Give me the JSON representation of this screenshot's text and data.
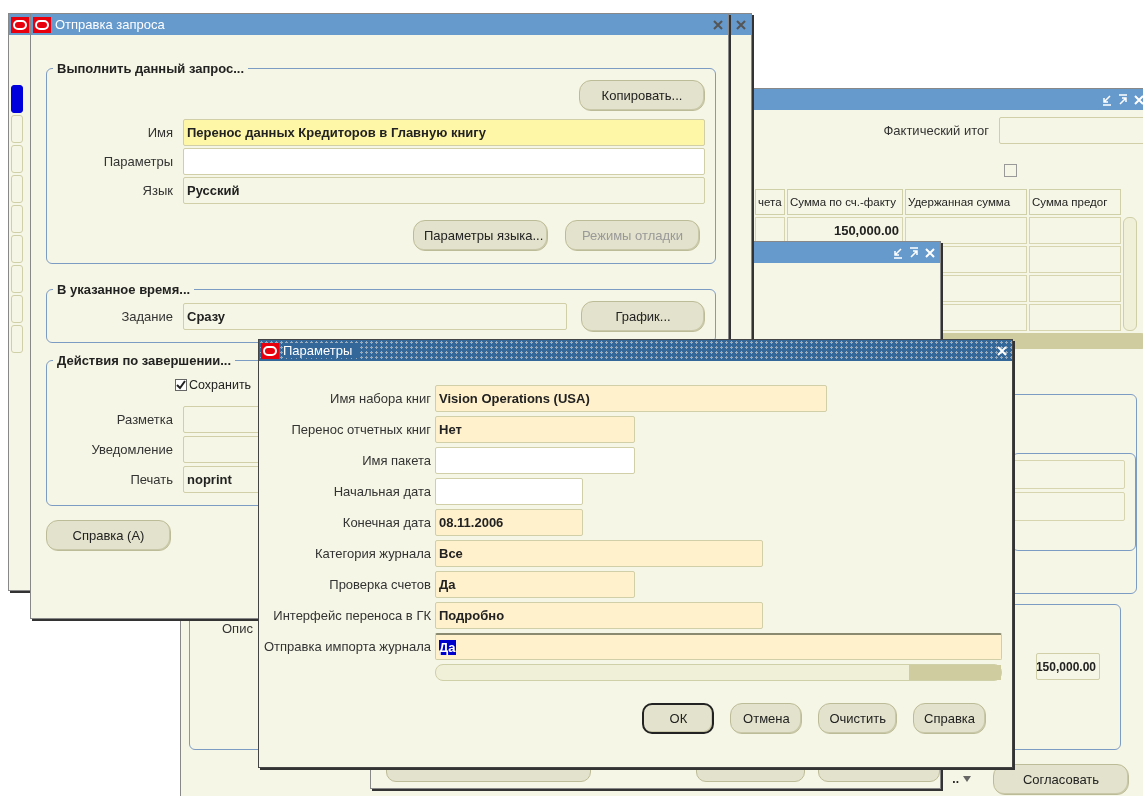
{
  "background_window": {
    "tab_marker": {
      "selected": true
    }
  },
  "invoice_window": {
    "total_label": "Фактический итог",
    "flag": {
      "checked": false
    },
    "columns": [
      "чета",
      "Сумма по сч.-факту",
      "Удержанная сумма",
      "Сумма предог"
    ],
    "rows": [
      [
        null,
        "150,000.00",
        null,
        null
      ],
      [
        null,
        null,
        null,
        null
      ],
      [
        null,
        null,
        null,
        null
      ],
      [
        null,
        null,
        null,
        null
      ]
    ],
    "description_label": "Опис",
    "amount": "150,000.00",
    "list_value": "..",
    "approve_button": "Согласовать"
  },
  "request_window": {
    "title": "Отправка запроса",
    "run_section": {
      "title": "Выполнить данный запрос...",
      "copy_button": "Копировать...",
      "fields": [
        {
          "label": "Имя",
          "value": "Перенос данных Кредиторов в Главную книгу",
          "kind": "required"
        },
        {
          "label": "Параметры",
          "kind": "editable"
        },
        {
          "label": "Язык",
          "value": "Русский",
          "kind": "readonly"
        }
      ],
      "buttons": [
        {
          "label": "Параметры языка...",
          "disabled": false
        },
        {
          "label": "Режимы отладки",
          "disabled": true
        }
      ]
    },
    "schedule_section": {
      "title": "В указанное время...",
      "field": {
        "label": "Задание",
        "value": "Сразу",
        "kind": "readonly"
      },
      "schedule_button": "График..."
    },
    "completion_section": {
      "title": "Действия по завершении...",
      "save_checkbox": {
        "label": "Сохранить",
        "checked": true
      },
      "fields": [
        {
          "label": "Разметка",
          "kind": "readonly"
        },
        {
          "label": "Уведомление",
          "kind": "readonly"
        },
        {
          "label": "Печать",
          "value": "noprint",
          "kind": "readonly"
        }
      ]
    },
    "help_button": "Справка (А)"
  },
  "parameters_dialog": {
    "title": "Параметры",
    "fields": [
      {
        "label": "Имя набора книг",
        "value": "Vision Operations (USA)",
        "required": true,
        "text_selected": false
      },
      {
        "label": "Перенос отчетных книг",
        "value": "Нет",
        "required": true,
        "text_selected": false
      },
      {
        "label": "Имя пакета",
        "required": false,
        "text_selected": false
      },
      {
        "label": "Начальная дата",
        "required": false,
        "text_selected": false
      },
      {
        "label": "Конечная дата",
        "value": "08.11.2006",
        "required": true,
        "text_selected": false
      },
      {
        "label": "Категория журнала",
        "value": "Все",
        "required": true,
        "text_selected": false
      },
      {
        "label": "Проверка счетов",
        "value": "Да",
        "required": true,
        "text_selected": false
      },
      {
        "label": "Интерфейс переноса в ГК",
        "value": "Подробно",
        "required": true,
        "text_selected": false
      },
      {
        "label": "Отправка импорта журнала",
        "value": "Да",
        "required": true,
        "text_selected": true
      }
    ],
    "buttons": [
      {
        "label": "ОК",
        "default": true
      },
      {
        "label": "Отмена",
        "default": false
      },
      {
        "label": "Очистить",
        "default": false
      },
      {
        "label": "Справка",
        "default": false
      }
    ]
  }
}
